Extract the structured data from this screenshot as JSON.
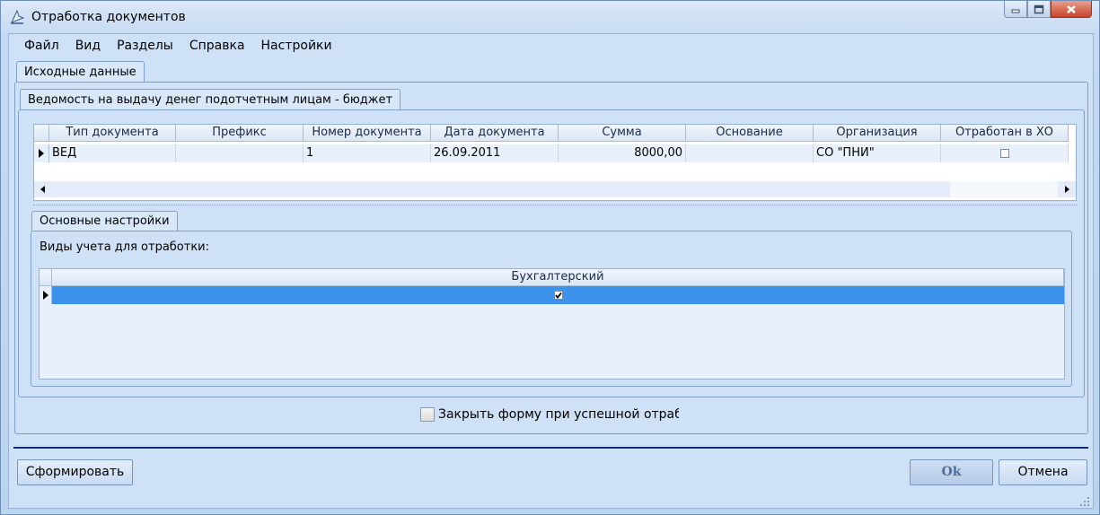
{
  "window": {
    "title": "Отработка документов",
    "icon": "app-icon"
  },
  "menu": [
    "Файл",
    "Вид",
    "Разделы",
    "Справка",
    "Настройки"
  ],
  "tabs": {
    "source": "Исходные данные",
    "statement": "Ведомость на выдачу денег подотчетным лицам - бюджет",
    "settings": "Основные настройки"
  },
  "documents_grid": {
    "columns": [
      "Тип документа",
      "Префикс",
      "Номер документа",
      "Дата документа",
      "Сумма",
      "Основание",
      "Организация",
      "Отработан в ХО"
    ],
    "rows": [
      {
        "type": "ВЕД",
        "prefix": "",
        "number": "1",
        "date": "26.09.2011",
        "sum": "8000,00",
        "basis": "",
        "org": "СО \"ПНИ\"",
        "processed": false
      }
    ]
  },
  "settings": {
    "label": "Виды учета для отработки:",
    "columns": [
      "Бухгалтерский"
    ],
    "rows": [
      {
        "accounting": true
      }
    ]
  },
  "close_on_success": {
    "label": "Закрыть форму при успешной отработке",
    "checked": false
  },
  "buttons": {
    "generate": "Сформировать",
    "ok": "Ok",
    "cancel": "Отмена"
  },
  "colors": {
    "selected_row": "#3d93ec",
    "separator": "#0b2f7a"
  }
}
